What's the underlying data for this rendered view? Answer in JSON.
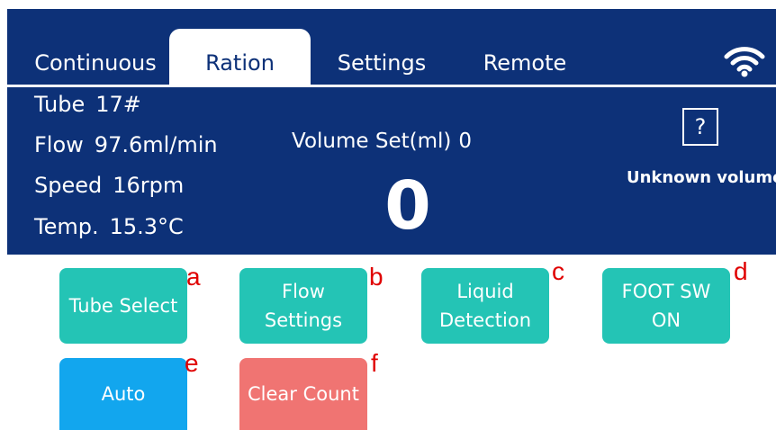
{
  "tabs": [
    {
      "label": "Continuous",
      "active": false
    },
    {
      "label": "Ration",
      "active": true
    },
    {
      "label": "Settings",
      "active": false
    },
    {
      "label": "Remote",
      "active": false
    }
  ],
  "status": {
    "tube": {
      "label": "Tube",
      "value": "17#"
    },
    "flow": {
      "label": "Flow",
      "value": "97.6ml/min"
    },
    "speed": {
      "label": "Speed",
      "value": "16rpm"
    },
    "temp": {
      "label": "Temp.",
      "value": "15.3°C"
    }
  },
  "volume": {
    "set_label": "Volume Set(ml)",
    "set_value": "0",
    "count": "0",
    "unknown_icon": "?",
    "unknown_label": "Unknown volume"
  },
  "buttons": {
    "tube_select": [
      "Tube Select"
    ],
    "flow_settings": [
      "Flow",
      "Settings"
    ],
    "liquid_detection": [
      "Liquid",
      "Detection"
    ],
    "foot_sw": [
      "FOOT SW",
      "ON"
    ],
    "auto": [
      "Auto"
    ],
    "clear_count": [
      "Clear Count"
    ]
  },
  "annotations": [
    "a",
    "b",
    "c",
    "d",
    "e",
    "f"
  ],
  "icons": {
    "wifi": "wifi-icon",
    "unknown": "question-box-icon"
  },
  "colors": {
    "panel": "#0d3178",
    "teal_button": "#24c4b5",
    "auto_button": "#12a6ee",
    "clear_button": "#f07472",
    "annotation": "#e00000"
  }
}
